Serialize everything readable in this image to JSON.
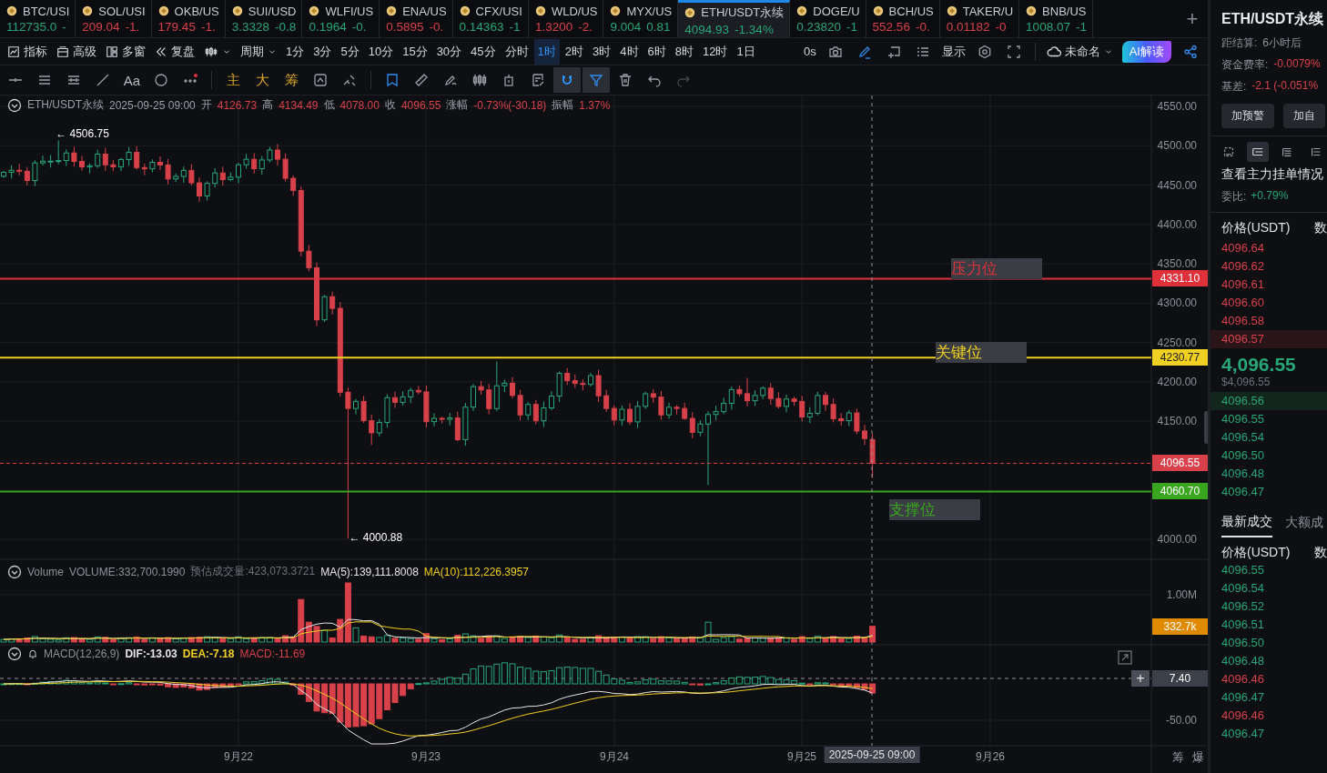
{
  "tabs": [
    {
      "symbol": "BTC/USI",
      "price": "112735.0",
      "change": "-",
      "rising": true,
      "selected": false
    },
    {
      "symbol": "SOL/USI",
      "price": "209.04",
      "change": "-1.",
      "rising": false,
      "selected": false
    },
    {
      "symbol": "OKB/US",
      "price": "179.45",
      "change": "-1.",
      "rising": false,
      "selected": false
    },
    {
      "symbol": "SUI/USD",
      "price": "3.3328",
      "change": "-0.8",
      "rising": true,
      "selected": false
    },
    {
      "symbol": "WLFI/US",
      "price": "0.1964",
      "change": "-0.",
      "rising": true,
      "selected": false
    },
    {
      "symbol": "ENA/US",
      "price": "0.5895",
      "change": "-0.",
      "rising": false,
      "selected": false
    },
    {
      "symbol": "CFX/USI",
      "price": "0.14363",
      "change": "-1",
      "rising": true,
      "selected": false
    },
    {
      "symbol": "WLD/US",
      "price": "1.3200",
      "change": "-2.",
      "rising": false,
      "selected": false
    },
    {
      "symbol": "MYX/US",
      "price": "9.004",
      "change": "0.81",
      "rising": true,
      "selected": false
    },
    {
      "symbol": "ETH/USDT永续",
      "price": "4094.93",
      "change": "-1.34%",
      "rising": true,
      "selected": true
    },
    {
      "symbol": "DOGE/U",
      "price": "0.23820",
      "change": "-1",
      "rising": true,
      "selected": false
    },
    {
      "symbol": "BCH/US",
      "price": "552.56",
      "change": "-0.",
      "rising": false,
      "selected": false
    },
    {
      "symbol": "TAKER/U",
      "price": "0.01182",
      "change": "-0",
      "rising": false,
      "selected": false
    },
    {
      "symbol": "BNB/US",
      "price": "1008.07",
      "change": "-1",
      "rising": true,
      "selected": false
    }
  ],
  "add_tab": "+",
  "menus": [
    "指标",
    "高级",
    "多窗",
    "复盘"
  ],
  "period_menu": "周期",
  "intervals": [
    {
      "label": "1分",
      "selected": false
    },
    {
      "label": "3分",
      "selected": false
    },
    {
      "label": "5分",
      "selected": false
    },
    {
      "label": "10分",
      "selected": false
    },
    {
      "label": "15分",
      "selected": false
    },
    {
      "label": "30分",
      "selected": false
    },
    {
      "label": "45分",
      "selected": false
    },
    {
      "label": "分时",
      "selected": false
    },
    {
      "label": "1时",
      "selected": true
    },
    {
      "label": "2时",
      "selected": false
    },
    {
      "label": "3时",
      "selected": false
    },
    {
      "label": "4时",
      "selected": false
    },
    {
      "label": "6时",
      "selected": false
    },
    {
      "label": "8时",
      "selected": false
    },
    {
      "label": "12时",
      "selected": false
    },
    {
      "label": "1日",
      "selected": false
    }
  ],
  "tools": [
    {
      "kind": "text",
      "label": "0s",
      "highlighted": false
    },
    {
      "kind": "icon",
      "highlighted": false
    },
    {
      "kind": "icon",
      "highlighted": true
    },
    {
      "kind": "icon",
      "highlighted": false
    },
    {
      "kind": "icon",
      "highlighted": false
    },
    {
      "kind": "text",
      "label": "显示",
      "highlighted": false
    },
    {
      "kind": "icon",
      "highlighted": false
    },
    {
      "kind": "icon",
      "highlighted": false
    }
  ],
  "layout_menu": "未命名",
  "ai_button": "AI解读",
  "drawing_tools": [
    {
      "kind": "icon",
      "selected": false,
      "highlighted": false,
      "disabled": false
    },
    {
      "kind": "icon",
      "selected": false,
      "highlighted": false,
      "disabled": false
    },
    {
      "kind": "icon",
      "selected": false,
      "highlighted": false,
      "disabled": false
    },
    {
      "kind": "icon",
      "selected": false,
      "highlighted": false,
      "disabled": false
    },
    {
      "kind": "text",
      "label": "Aa"
    },
    {
      "kind": "icon",
      "selected": false,
      "highlighted": false,
      "disabled": false
    },
    {
      "kind": "icon",
      "selected": false,
      "highlighted": false,
      "disabled": false
    },
    {
      "kind": "divider"
    },
    {
      "kind": "text",
      "label": "主",
      "gold": true
    },
    {
      "kind": "text",
      "label": "大",
      "gold": true
    },
    {
      "kind": "text",
      "label": "筹",
      "gold": true
    },
    {
      "kind": "icon",
      "selected": false,
      "highlighted": false,
      "disabled": false
    },
    {
      "kind": "icon",
      "selected": false,
      "highlighted": false,
      "disabled": false
    },
    {
      "kind": "divider"
    },
    {
      "kind": "icon",
      "selected": false,
      "highlighted": true,
      "disabled": false
    },
    {
      "kind": "icon",
      "selected": false,
      "highlighted": false,
      "disabled": false
    },
    {
      "kind": "icon",
      "selected": false,
      "highlighted": false,
      "disabled": false
    },
    {
      "kind": "icon",
      "selected": false,
      "highlighted": false,
      "disabled": false
    },
    {
      "kind": "icon",
      "selected": false,
      "highlighted": false,
      "disabled": false
    },
    {
      "kind": "icon",
      "selected": false,
      "highlighted": false,
      "disabled": false
    },
    {
      "kind": "icon",
      "selected": true,
      "highlighted": true,
      "disabled": false
    },
    {
      "kind": "icon",
      "selected": true,
      "highlighted": true,
      "disabled": false
    },
    {
      "kind": "icon",
      "selected": false,
      "highlighted": false,
      "disabled": false
    },
    {
      "kind": "icon",
      "selected": false,
      "highlighted": false,
      "disabled": false
    },
    {
      "kind": "icon",
      "selected": false,
      "highlighted": false,
      "disabled": true
    }
  ],
  "chart": {
    "header": [
      {
        "kind": "label",
        "text": "ETH/USDT永续"
      },
      {
        "kind": "label",
        "text": "2025-09-25 09:00"
      },
      {
        "kind": "label",
        "text": "开"
      },
      {
        "kind": "value",
        "text": "4126.73"
      },
      {
        "kind": "label",
        "text": "高"
      },
      {
        "kind": "value",
        "text": "4134.49"
      },
      {
        "kind": "label",
        "text": "低"
      },
      {
        "kind": "value",
        "text": "4078.00"
      },
      {
        "kind": "label",
        "text": "收"
      },
      {
        "kind": "value",
        "text": "4096.55"
      },
      {
        "kind": "label",
        "text": "涨幅"
      },
      {
        "kind": "value",
        "text": "-0.73%(-30.18)"
      },
      {
        "kind": "label",
        "text": "振幅"
      },
      {
        "kind": "value",
        "text": "1.37%"
      }
    ],
    "price_ticks": [
      "4550.00",
      "4500.00",
      "4450.00",
      "4400.00",
      "4350.00",
      "4300.00",
      "4250.00",
      "4200.00",
      "4150.00",
      "4000.00"
    ],
    "levels": [
      {
        "kind": "resistance",
        "name": "压力位",
        "price": "4331.10",
        "color": "#e0303a"
      },
      {
        "kind": "key",
        "name": "关键位",
        "price": "4230.77",
        "color": "#f0d020"
      },
      {
        "kind": "support",
        "name": "支撑位",
        "price": "4060.70",
        "color": "#3aa51e"
      }
    ],
    "current_price": "4096.55",
    "high_marker": "← 4506.75",
    "low_marker": "← 4000.88"
  },
  "volume": {
    "header": [
      {
        "kind": "title",
        "text": "Volume"
      },
      {
        "kind": "volume",
        "text": "VOLUME:332,700.1990"
      },
      {
        "kind": "estimate",
        "text": "预估成交量:423,073.3721"
      },
      {
        "kind": "ma5",
        "text": "MA(5):139,111.8008"
      },
      {
        "kind": "ma10",
        "text": "MA(10):112,226.3957"
      }
    ],
    "tick": "1.00M",
    "current": "332.7k"
  },
  "macd": {
    "header": [
      {
        "kind": "title",
        "text": "MACD(12,26,9)"
      },
      {
        "kind": "dif",
        "text": "DIF:-13.03"
      },
      {
        "kind": "dea",
        "text": "DEA:-7.18"
      },
      {
        "kind": "macd",
        "text": "MACD:-11.69"
      }
    ],
    "crosshair_value": "7.40",
    "add_button": "+",
    "tick": "-50.00"
  },
  "x_axis": {
    "labels": [
      "9月22",
      "9月23",
      "9月24",
      "9月25",
      "9月26"
    ],
    "crosshair_label": "2025-09-25 09:00"
  },
  "corner_buttons": [
    "筹",
    "爆"
  ],
  "right_panel": {
    "title": "ETH/USDT永续",
    "info": [
      {
        "label": "距结算:",
        "value": "6小时后",
        "falling": false
      },
      {
        "label": "资金费率:",
        "value": "-0.0079%",
        "falling": true
      },
      {
        "label": "基差:",
        "value": "-2.1 (-0.051%",
        "falling": true
      }
    ],
    "buttons": [
      "加预警",
      "加自"
    ],
    "view_tabs": [
      {
        "selected": false
      },
      {
        "selected": true
      },
      {
        "selected": false
      },
      {
        "selected": false
      }
    ],
    "book_link": "查看主力挂单情况",
    "ratio": {
      "label": "委比:",
      "value": "+0.79%"
    },
    "book_columns": [
      "价格(USDT)",
      "数"
    ],
    "asks": [
      {
        "price": "4096.64",
        "highlighted": false
      },
      {
        "price": "4096.62",
        "highlighted": false
      },
      {
        "price": "4096.61",
        "highlighted": false
      },
      {
        "price": "4096.60",
        "highlighted": false
      },
      {
        "price": "4096.58",
        "highlighted": false
      },
      {
        "price": "4096.57",
        "highlighted": true
      }
    ],
    "last_price": "4,096.55",
    "last_price_usd": "$4,096.55",
    "bids": [
      {
        "price": "4096.56",
        "highlighted": true
      },
      {
        "price": "4096.55",
        "highlighted": false
      },
      {
        "price": "4096.54",
        "highlighted": false
      },
      {
        "price": "4096.50",
        "highlighted": false
      },
      {
        "price": "4096.48",
        "highlighted": false
      },
      {
        "price": "4096.47",
        "highlighted": false
      }
    ],
    "trade_tabs": [
      {
        "label": "最新成交",
        "selected": true
      },
      {
        "label": "大额成",
        "selected": false
      }
    ],
    "trade_columns": [
      "价格(USDT)",
      "数"
    ],
    "trades": [
      {
        "price": "4096.55",
        "rising": true
      },
      {
        "price": "4096.54",
        "rising": true
      },
      {
        "price": "4096.52",
        "rising": true
      },
      {
        "price": "4096.51",
        "rising": true
      },
      {
        "price": "4096.50",
        "rising": true
      },
      {
        "price": "4096.48",
        "rising": true
      },
      {
        "price": "4096.46",
        "rising": false
      },
      {
        "price": "4096.47",
        "rising": true
      },
      {
        "price": "4096.46",
        "rising": false
      },
      {
        "price": "4096.47",
        "rising": true
      }
    ]
  }
}
